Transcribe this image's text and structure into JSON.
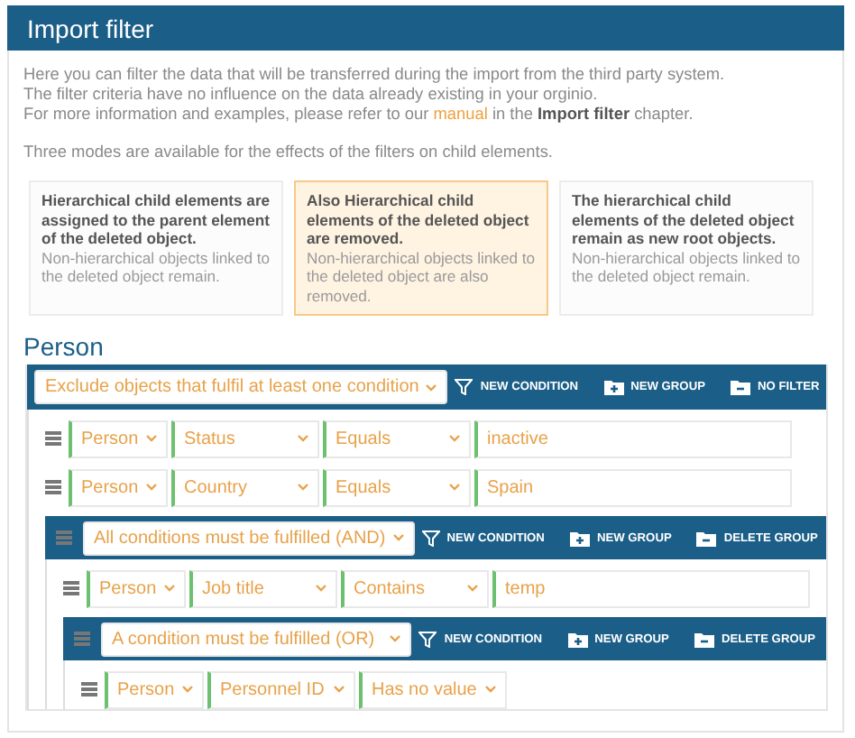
{
  "panel": {
    "title": "Import filter"
  },
  "intro": [
    "Here you can filter the data that will be transferred during the import from the third party system.",
    "The filter criteria have no influence on the data already existing in your orginio."
  ],
  "more_info": {
    "before": "For more information and examples, please refer to our",
    "link": "manual",
    "after": "in the **Import filter** chapter."
  },
  "modes_note": "Three modes are available for the effects of the filters on child elements.",
  "modes": [
    {
      "title": "Hierarchical child elements are assigned to the parent element of the deleted object.",
      "note": "Non-hierarchical objects linked to the deleted object remain.",
      "selected": false
    },
    {
      "title": "Also Hierarchical child elements of the deleted object are removed.",
      "note": "Non-hierarchical objects linked to the deleted object are also removed.",
      "selected": true
    },
    {
      "title": "The hierarchical child elements of the deleted object remain as new root objects.",
      "note": "Non-hierarchical objects linked to the deleted object remain.",
      "selected": false
    }
  ],
  "section_title": "Person",
  "filter": {
    "kind": "group",
    "mode": "Exclude objects that fulfil at least one condition",
    "actions": [
      {
        "kind": "condition",
        "label": "NEW CONDITION"
      },
      {
        "kind": "group",
        "label": "NEW GROUP"
      },
      {
        "kind": "remove",
        "label": "NO FILTER"
      }
    ],
    "children": [
      {
        "kind": "condition",
        "fields": [
          "Person",
          "Status",
          "Equals"
        ],
        "value": "inactive"
      },
      {
        "kind": "condition",
        "fields": [
          "Person",
          "Country",
          "Equals"
        ],
        "value": "Spain"
      },
      {
        "kind": "group",
        "mode": "All conditions must be fulfilled (AND)",
        "actions": [
          {
            "kind": "condition",
            "label": "NEW CONDITION"
          },
          {
            "kind": "group",
            "label": "NEW GROUP"
          },
          {
            "kind": "remove",
            "label": "DELETE GROUP"
          }
        ],
        "children": [
          {
            "kind": "condition",
            "fields": [
              "Person",
              "Job title",
              "Contains"
            ],
            "value": "temp"
          },
          {
            "kind": "group",
            "mode": "A condition must be fulfilled (OR)",
            "actions": [
              {
                "kind": "condition",
                "label": "NEW CONDITION"
              },
              {
                "kind": "group",
                "label": "NEW GROUP"
              },
              {
                "kind": "remove",
                "label": "DELETE GROUP"
              }
            ],
            "children": [
              {
                "kind": "condition",
                "fields": [
                  "Person",
                  "Personnel ID",
                  "Has no value"
                ]
              }
            ]
          }
        ]
      }
    ]
  }
}
